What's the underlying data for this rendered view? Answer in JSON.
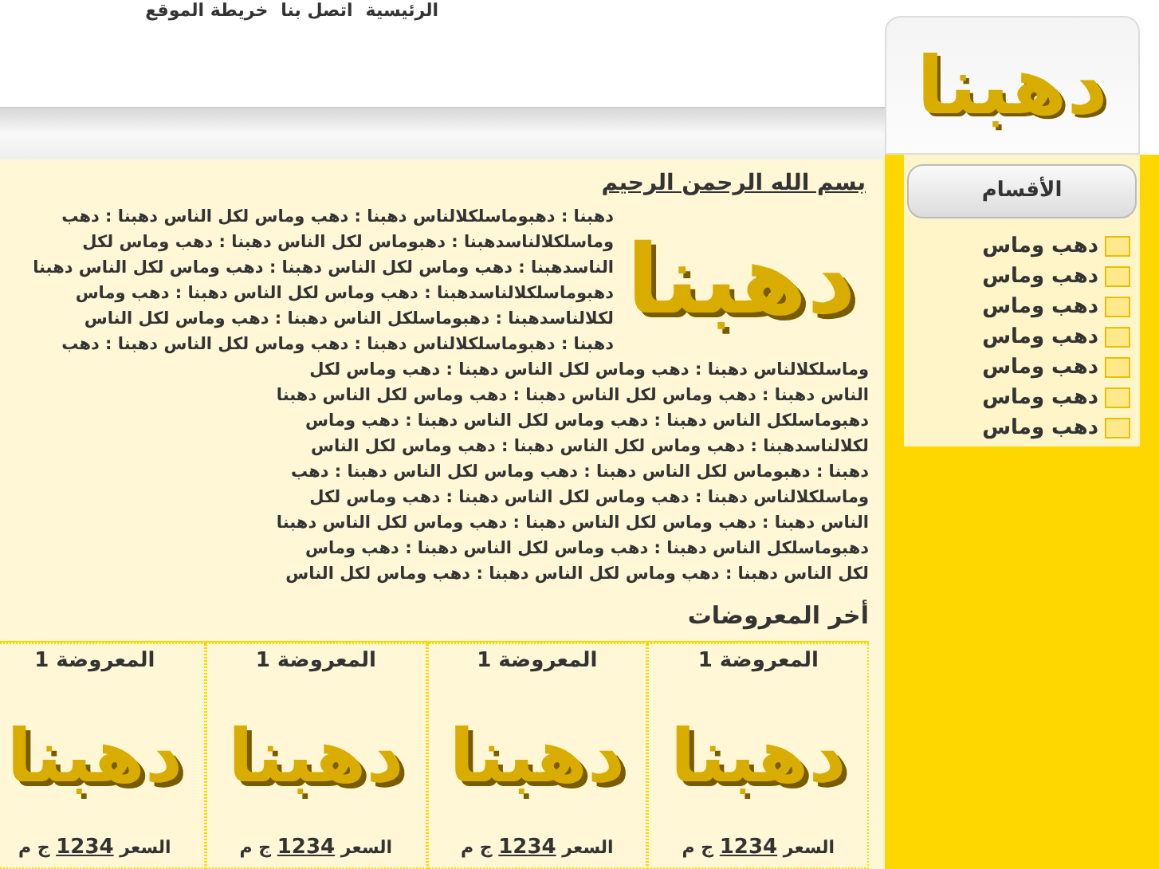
{
  "nav_links": [
    {
      "label": "الرئيسية"
    },
    {
      "label": "اتصل بنا"
    },
    {
      "label": "خريطة الموقع"
    }
  ],
  "sidebar": {
    "logo": "دهبنا",
    "header": "الأقسام",
    "items": [
      {
        "label": "دهب وماس"
      },
      {
        "label": "دهب وماس"
      },
      {
        "label": "دهب وماس"
      },
      {
        "label": "دهب وماس"
      },
      {
        "label": "دهب وماس"
      },
      {
        "label": "دهب وماس"
      },
      {
        "label": "دهب وماس"
      }
    ]
  },
  "content": {
    "heading": "بسم الله الرحمن الرحيم",
    "logo": "دهبنا",
    "paragraph_lines": [
      "دهبنا : دهبوماسلكلالناس دهبنا : دهب وماس لكل الناس دهبنا : دهب",
      "وماسلكلالناسدهبنا : دهبوماس لكل الناس دهبنا : دهب وماس لكل",
      "الناسدهبنا : دهب وماس لكل الناس دهبنا : دهب وماس لكل الناس دهبنا",
      "دهبوماسلكلالناسدهبنا : دهب وماس لكل الناس دهبنا : دهب وماس",
      "لكلالناسدهبنا : دهبوماسلكل الناس دهبنا : دهب وماس لكل الناس",
      "دهبنا : دهبوماسلكلالناس دهبنا : دهب وماس لكل الناس دهبنا : دهب",
      "وماسلكلالناس دهبنا : دهب وماس لكل الناس دهبنا : دهب وماس لكل",
      "الناس دهبنا : دهب وماس لكل الناس دهبنا : دهب وماس لكل الناس دهبنا",
      "دهبوماسلكل الناس دهبنا : دهب وماس لكل الناس دهبنا : دهب وماس",
      "لكلالناسدهبنا : دهب وماس لكل الناس دهبنا : دهب وماس لكل الناس",
      "دهبنا : دهبوماس لكل الناس دهبنا : دهب وماس لكل الناس دهبنا : دهب",
      "وماسلكلالناس دهبنا : دهب وماس لكل الناس دهبنا : دهب وماس لكل",
      "الناس دهبنا : دهب وماس لكل الناس دهبنا : دهب وماس لكل الناس دهبنا",
      "دهبوماسلكل الناس دهبنا : دهب وماس لكل الناس دهبنا : دهب وماس",
      "لكل الناس دهبنا : دهب وماس لكل الناس دهبنا : دهب وماس لكل الناس"
    ],
    "latest_heading": "أخر المعروضات",
    "products": [
      {
        "title": "المعروضة 1",
        "logo": "دهبنا",
        "price_label": "السعر",
        "price": "1234",
        "currency": "ج م"
      },
      {
        "title": "المعروضة 1",
        "logo": "دهبنا",
        "price_label": "السعر",
        "price": "1234",
        "currency": "ج م"
      },
      {
        "title": "المعروضة 1",
        "logo": "دهبنا",
        "price_label": "السعر",
        "price": "1234",
        "currency": "ج م"
      },
      {
        "title": "المعروضة 1",
        "logo": "دهبنا",
        "price_label": "السعر",
        "price": "1234",
        "currency": "ج م"
      }
    ]
  }
}
